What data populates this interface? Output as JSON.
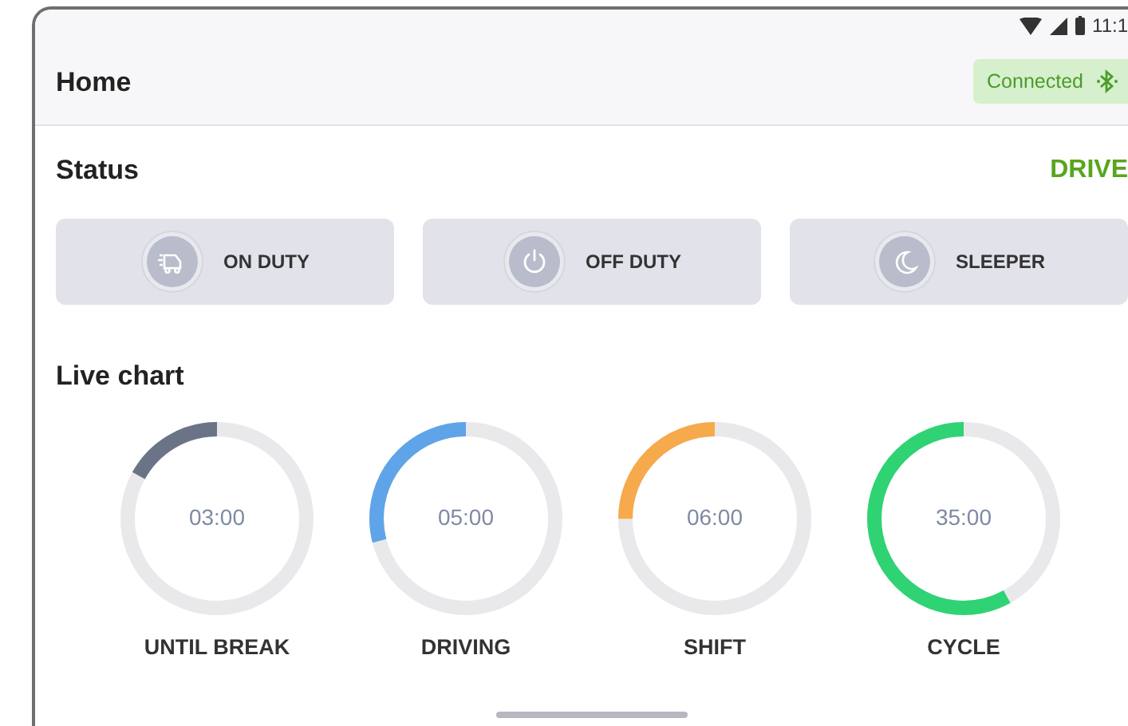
{
  "status_bar": {
    "time": "11:1"
  },
  "header": {
    "title": "Home",
    "connection": {
      "label": "Connected"
    }
  },
  "status": {
    "title": "Status",
    "current": "DRIVE"
  },
  "duty_buttons": [
    {
      "label": "ON DUTY",
      "kind": "truck",
      "selected": false
    },
    {
      "label": "OFF DUTY",
      "kind": "power",
      "selected": false
    },
    {
      "label": "SLEEPER",
      "kind": "moon",
      "selected": false
    }
  ],
  "live_chart": {
    "title": "Live chart",
    "gauges": [
      {
        "value": "03:00",
        "label": "UNTIL BREAK",
        "color": "#6b7387"
      },
      {
        "value": "05:00",
        "label": "DRIVING",
        "color": "#5fa4e8"
      },
      {
        "value": "06:00",
        "label": "SHIFT",
        "color": "#f6aa4b"
      },
      {
        "value": "35:00",
        "label": "CYCLE",
        "color": "#2fd373"
      }
    ]
  }
}
